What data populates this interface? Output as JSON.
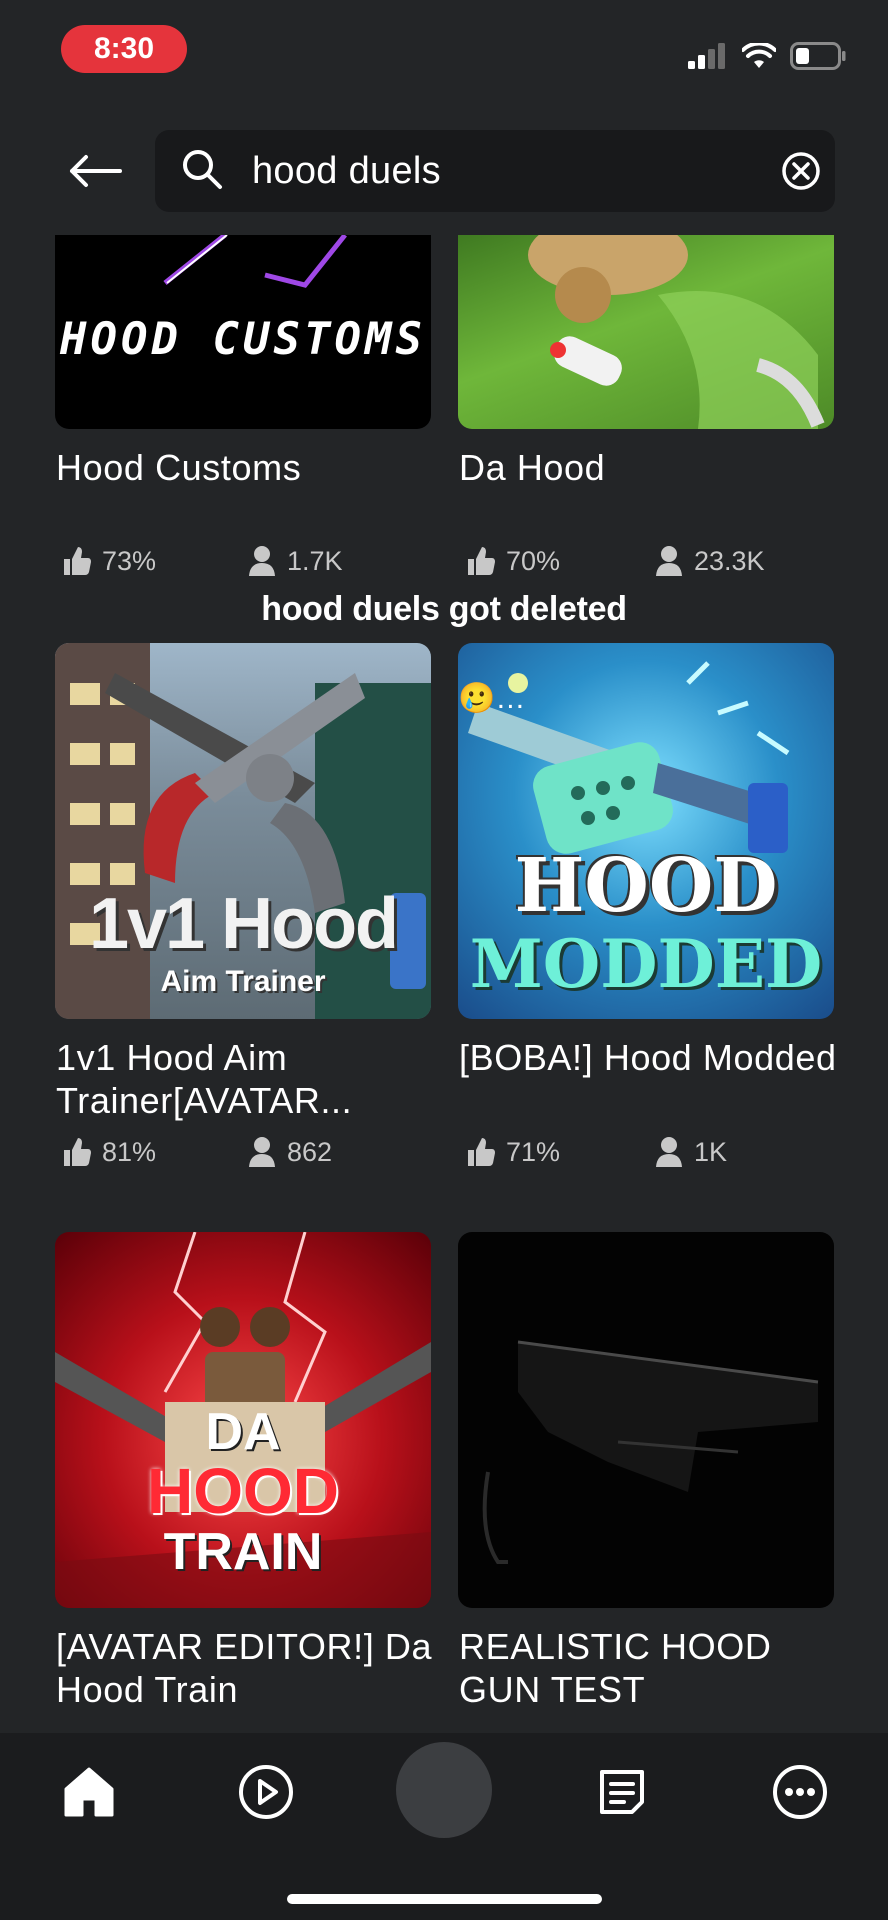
{
  "status_bar": {
    "time": "8:30",
    "accent_color": "#e5343c"
  },
  "search": {
    "query": "hood duels"
  },
  "caption": "hood duels got deleted",
  "emoji": "🥲…",
  "games": [
    {
      "title": "Hood Customs",
      "rating": "73%",
      "players": "1.7K",
      "thumb_text": "HOOD CUSTOMS"
    },
    {
      "title": "Da Hood",
      "rating": "70%",
      "players": "23.3K"
    },
    {
      "title": "1v1 Hood Aim Trainer[AVATAR...",
      "rating": "81%",
      "players": "862",
      "thumb_text_1": "1v1 Hood",
      "thumb_text_2": "Aim Trainer"
    },
    {
      "title": "[BOBA!] Hood Modded",
      "rating": "71%",
      "players": "1K",
      "thumb_text_1": "HOOD",
      "thumb_text_2": "MODDED"
    },
    {
      "title": "[AVATAR EDITOR!] Da Hood Train",
      "thumb_text_1": "DA",
      "thumb_text_2": "HOOD",
      "thumb_text_3": "TRAIN"
    },
    {
      "title": "REALISTIC HOOD GUN TEST"
    }
  ],
  "nav": {
    "items": [
      {
        "name": "home-icon"
      },
      {
        "name": "play-icon"
      },
      {
        "name": "avatar"
      },
      {
        "name": "notes-icon"
      },
      {
        "name": "more-icon"
      }
    ]
  }
}
